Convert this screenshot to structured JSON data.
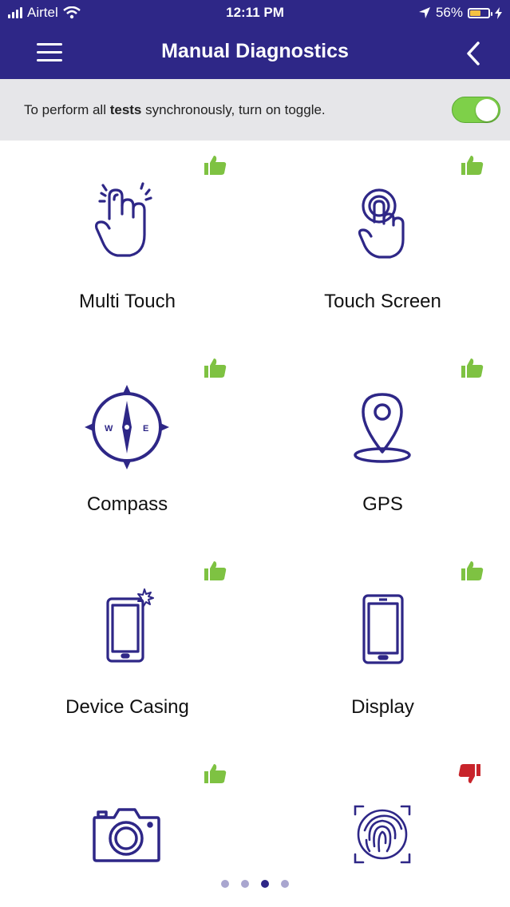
{
  "status": {
    "carrier": "Airtel",
    "time": "12:11 PM",
    "battery": "56%"
  },
  "header": {
    "title": "Manual Diagnostics"
  },
  "banner": {
    "text_pre": "To perform all ",
    "text_bold": "tests",
    "text_post": " synchronously, turn on toggle.",
    "toggle_on": true
  },
  "tests": [
    {
      "label": "Multi Touch",
      "icon": "multi-touch-icon",
      "status": "pass"
    },
    {
      "label": "Touch Screen",
      "icon": "touch-screen-icon",
      "status": "pass"
    },
    {
      "label": "Compass",
      "icon": "compass-icon",
      "status": "pass",
      "compass_letters": [
        "W",
        "E"
      ]
    },
    {
      "label": "GPS",
      "icon": "gps-pin-icon",
      "status": "pass"
    },
    {
      "label": "Device Casing",
      "icon": "device-casing-icon",
      "status": "pass"
    },
    {
      "label": "Display",
      "icon": "display-icon",
      "status": "pass"
    },
    {
      "label": "",
      "icon": "camera-icon",
      "status": "pass"
    },
    {
      "label": "",
      "icon": "fingerprint-icon",
      "status": "fail"
    }
  ],
  "pager": {
    "count": 4,
    "active": 2
  },
  "colors": {
    "brand": "#2e2787",
    "pass": "#7ec242",
    "fail": "#c8242b",
    "toggle": "#7ed049"
  }
}
